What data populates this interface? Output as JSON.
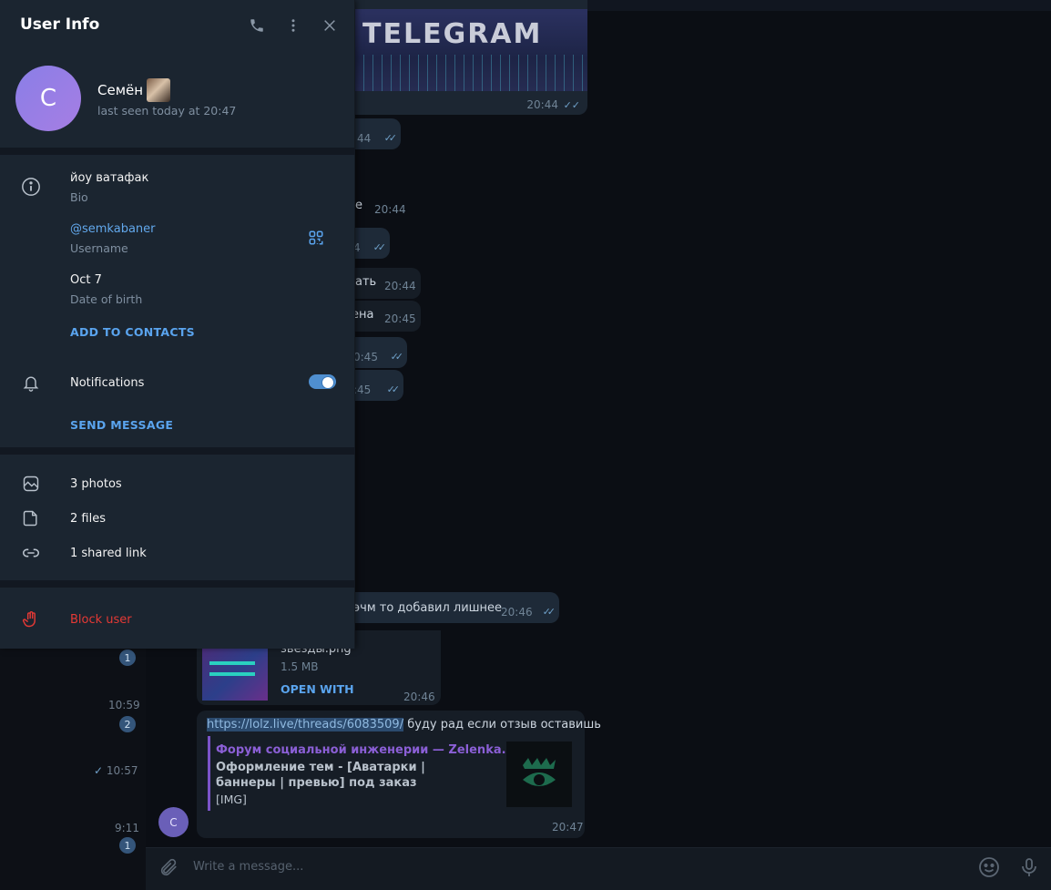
{
  "panel": {
    "title": "User Info",
    "user": {
      "avatar_letter": "С",
      "name": "Семён",
      "last_seen": "last seen today at 20:47"
    },
    "info": {
      "bio_value": "йоу ватафак",
      "bio_label": "Bio",
      "username_value": "@semkabaner",
      "username_label": "Username",
      "birth_value": "Oct 7",
      "birth_label": "Date of birth",
      "add_contacts": "ADD TO CONTACTS",
      "notifications_label": "Notifications",
      "notifications_on": true,
      "send_message": "SEND MESSAGE"
    },
    "media": {
      "photos": "3 photos",
      "files": "2 files",
      "links": "1 shared link"
    },
    "block": "Block user"
  },
  "chat": {
    "banner_text": "TELEGRAM",
    "messages": [
      {
        "text": "",
        "time": "20:44"
      },
      {
        "text": "",
        "time": "44"
      },
      {
        "text": "е",
        "time": "20:44"
      },
      {
        "text": "",
        "time": "4"
      },
      {
        "text": "ать",
        "time": "20:44"
      },
      {
        "text": "ена",
        "time": "20:45"
      },
      {
        "text": "",
        "time": "0:45"
      },
      {
        "text": "",
        "time": ":45"
      },
      {
        "text": "эчм то добавил лишнее",
        "time": "20:46"
      }
    ],
    "file": {
      "name": "звезды.png",
      "size": "1.5 MB",
      "open_with": "OPEN WITH",
      "time": "20:46"
    },
    "link_message": {
      "url": "https://lolz.live/threads/6083509/",
      "text": " буду рад если отзыв оставишь",
      "preview_site": "Форум социальной инженерии — Zelenka.gu...",
      "preview_title": "Оформление тем - [Аватарки | баннеры | превью] под заказ",
      "preview_desc": "[IMG]",
      "time": "20:47",
      "avatar_letter": "С"
    },
    "composer_placeholder": "Write a message..."
  },
  "dialogs": [
    {
      "time": "",
      "badge": "1"
    },
    {
      "time": "10:59",
      "badge": "2"
    },
    {
      "time": "10:57",
      "badge": ""
    },
    {
      "time": "9:11",
      "badge": "1"
    }
  ],
  "colors": {
    "accent": "#5aa4ee",
    "danger": "#e53935",
    "panel_bg": "#1b2530"
  }
}
